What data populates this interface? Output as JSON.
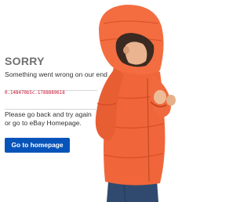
{
  "error": {
    "title": "SORRY",
    "subtitle": "Something went wrong on our end",
    "code": "0.148470b5c.1788889618",
    "message_line1": "Please go back and try again",
    "message_line2": "or go to eBay Homepage."
  },
  "actions": {
    "home_button_label": "Go to homepage"
  },
  "colors": {
    "accent": "#0654ba",
    "error_code": "#c8102e",
    "jacket": "#f0663a",
    "title": "#707070"
  }
}
